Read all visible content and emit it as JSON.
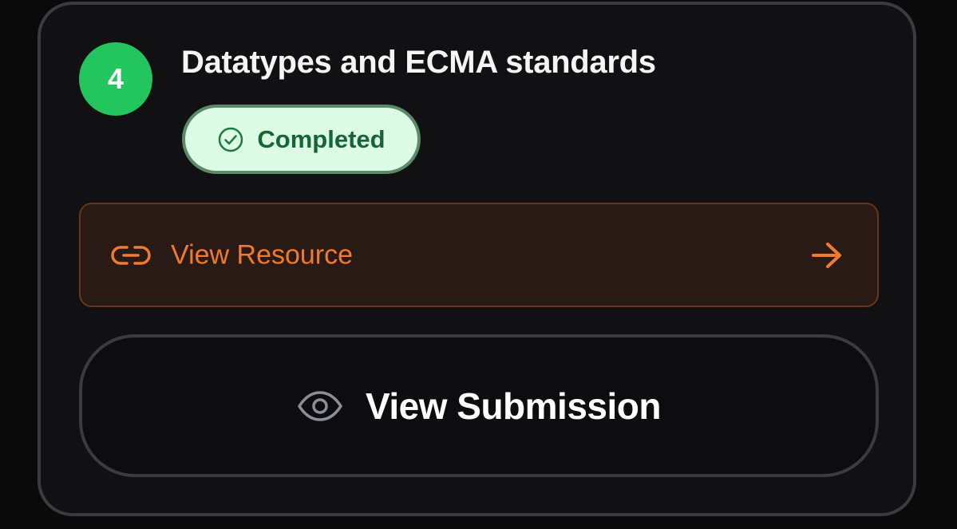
{
  "step": {
    "number": "4",
    "title": "Datatypes and ECMA standards",
    "status": {
      "label": "Completed",
      "icon": "check-circle-icon",
      "color": "#166534",
      "background": "#dcfbe5"
    }
  },
  "actions": {
    "resource": {
      "label": "View Resource",
      "icon": "link-icon",
      "trailing_icon": "arrow-right-icon",
      "accent": "#f07a2f"
    },
    "submission": {
      "label": "View Submission",
      "icon": "eye-icon"
    }
  },
  "colors": {
    "badge": "#22c55e",
    "card_background": "#111113",
    "card_border": "#3a3a3f"
  }
}
